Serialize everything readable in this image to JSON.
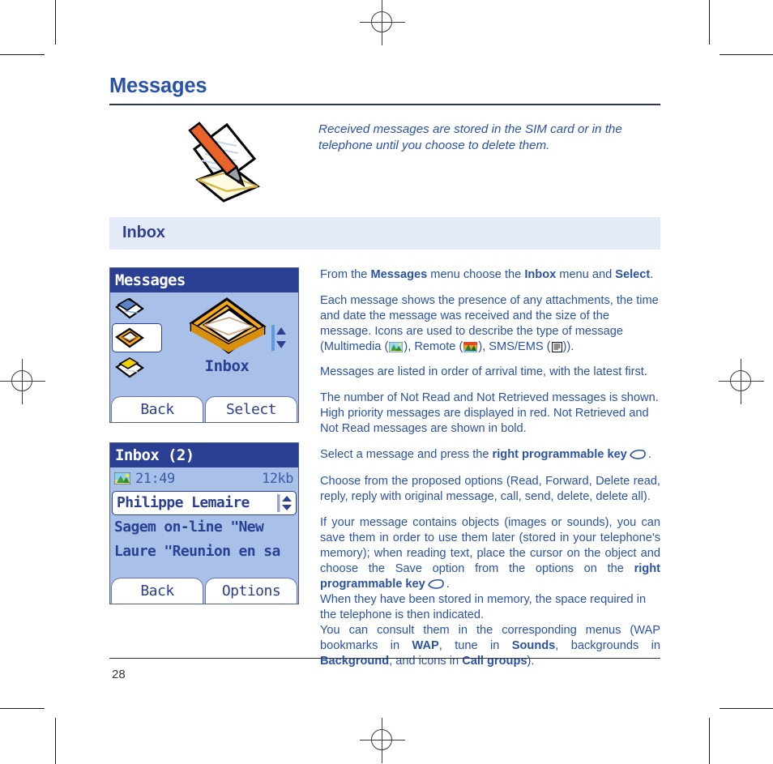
{
  "document": {
    "chapter_title": "Messages",
    "page_number": "28",
    "intro_text": "Received messages are stored in the SIM card or in the telephone until you choose to delete them."
  },
  "section": {
    "title": "Inbox"
  },
  "phone_screen_1": {
    "title": "Messages",
    "selected_label": "Inbox",
    "softkey_left": "Back",
    "softkey_right": "Select",
    "icon_names": [
      "messages-list-icon",
      "inbox-tray-icon",
      "outbox-icon"
    ]
  },
  "phone_screen_2": {
    "title": "Inbox (2)",
    "message_time": "21:49",
    "message_size": "12kb",
    "rows": [
      "Philippe Lemaire",
      "Sagem on-line \"New",
      "Laure \"Reunion en sa"
    ],
    "softkey_left": "Back",
    "softkey_right": "Options"
  },
  "body": {
    "p1": {
      "a": "From the ",
      "b1": "Messages",
      "c": " menu choose the ",
      "b2": "Inbox",
      "d": " menu and ",
      "b3": "Select",
      "e": "."
    },
    "p2": {
      "a": "Each message shows the presence of any attachments, the time and date the message was received and the size of the message. Icons are used to describe the type of message (Multimedia (",
      "b": "), Remote (",
      "c": "), SMS/EMS (",
      "d": "))."
    },
    "p3": "Messages are listed in order of arrival time, with the latest first.",
    "p4": "The number of Not Read and Not Retrieved messages is shown.  High priority messages are displayed in red. Not Retrieved and Not Read messages are shown in bold.",
    "p5": {
      "a": "Select a message and press the ",
      "b": "right programmable key",
      "c": "."
    },
    "p6": "Choose from the proposed options (Read, Forward, Delete read, reply, reply with original message, call, send, delete, delete all).",
    "p7": {
      "a": "If your message contains objects (images or sounds), you can save them in order to use them later (stored in your telephone's memory); when reading text, place the cursor on the object and choose the Save option from the options on the ",
      "b": "right programmable key",
      "c": "."
    },
    "p8": "When they have been stored in memory, the space required in the telephone is then indicated.",
    "p9": {
      "a": "You can consult them in the corresponding menus (WAP bookmarks in ",
      "b1": "WAP",
      "c": ", tune in ",
      "b2": "Sounds",
      "d": ", backgrounds in ",
      "b3": "Background",
      "e": ", and icons in ",
      "b4": "Call groups",
      "f": ")."
    }
  },
  "colors": {
    "heading_blue": "#2a52a8",
    "band_bg": "#e4eaf6",
    "band_text": "#30418c",
    "phone_title_bg": "#2b3f93",
    "phone_body_bg": "#a9c0e8",
    "rule": "#2f3640"
  }
}
